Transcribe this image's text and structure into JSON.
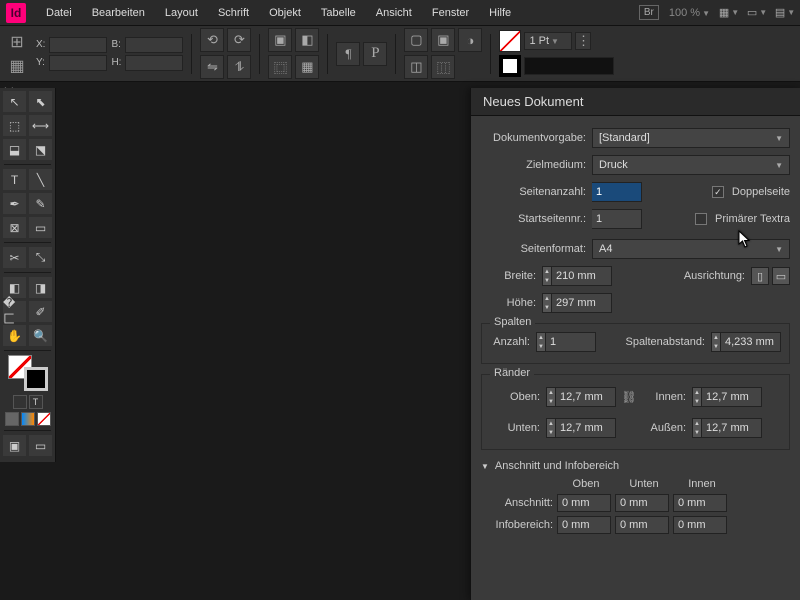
{
  "app": {
    "icon_text": "Id"
  },
  "menu": {
    "items": [
      "Datei",
      "Bearbeiten",
      "Layout",
      "Schrift",
      "Objekt",
      "Tabelle",
      "Ansicht",
      "Fenster",
      "Hilfe"
    ]
  },
  "topbar": {
    "br": "Br",
    "zoom": "100 %"
  },
  "controlbar": {
    "xy": {
      "x": "X:",
      "y": "Y:",
      "w": "B:",
      "h": "H:"
    },
    "stroke_weight": "1 Pt"
  },
  "dialog": {
    "title": "Neues Dokument",
    "preset_lbl": "Dokumentvorgabe:",
    "preset_val": "[Standard]",
    "intent_lbl": "Zielmedium:",
    "intent_val": "Druck",
    "pages_lbl": "Seitenanzahl:",
    "pages_val": "1",
    "facing_lbl": "Doppelseite",
    "start_lbl": "Startseitennr.:",
    "start_val": "1",
    "primary_lbl": "Primärer Textra",
    "format_lbl": "Seitenformat:",
    "format_val": "A4",
    "width_lbl": "Breite:",
    "width_val": "210 mm",
    "orient_lbl": "Ausrichtung:",
    "height_lbl": "Höhe:",
    "height_val": "297 mm",
    "cols": {
      "legend": "Spalten",
      "count_lbl": "Anzahl:",
      "count_val": "1",
      "gutter_lbl": "Spaltenabstand:",
      "gutter_val": "4,233 mm"
    },
    "margins": {
      "legend": "Ränder",
      "top_lbl": "Oben:",
      "top_val": "12,7 mm",
      "bottom_lbl": "Unten:",
      "bottom_val": "12,7 mm",
      "inside_lbl": "Innen:",
      "inside_val": "12,7 mm",
      "outside_lbl": "Außen:",
      "outside_val": "12,7 mm"
    },
    "bleed": {
      "legend": "Anschnitt und Infobereich",
      "hdr_top": "Oben",
      "hdr_bottom": "Unten",
      "hdr_inside": "Innen",
      "bleed_lbl": "Anschnitt:",
      "bleed_top": "0 mm",
      "bleed_bottom": "0 mm",
      "bleed_inside": "0 mm",
      "slug_lbl": "Infobereich:",
      "slug_top": "0 mm",
      "slug_bottom": "0 mm",
      "slug_inside": "0 mm"
    }
  }
}
